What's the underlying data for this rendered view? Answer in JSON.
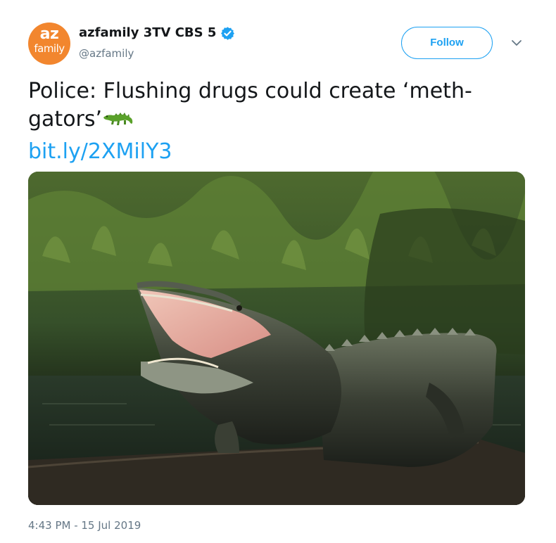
{
  "account": {
    "avatar_line1": "az",
    "avatar_line2": "family",
    "display_name": "azfamily 3TV CBS 5",
    "handle": "@azfamily",
    "verified": true
  },
  "actions": {
    "follow_label": "Follow",
    "more_icon": "chevron-down-icon"
  },
  "tweet": {
    "text_line1": "Police: Flushing drugs could create ‘meth-",
    "text_line2": "gators’",
    "emoji": "crocodile-emoji",
    "link": "bit.ly/2XMilY3",
    "timestamp": "4:43 PM - 15 Jul 2019"
  },
  "colors": {
    "accent": "#1da1f2",
    "avatar_bg": "#f2862e",
    "secondary_text": "#657786"
  }
}
